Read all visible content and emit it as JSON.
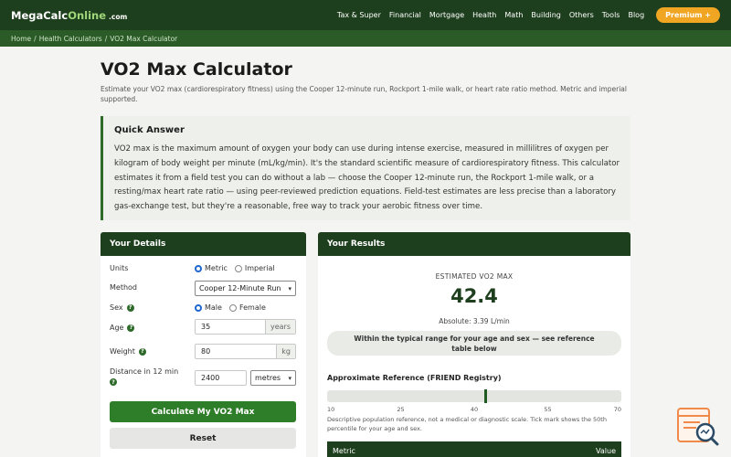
{
  "brand": {
    "name_main": "MegaCalc",
    "name_accent": "Online",
    "tld": ".com"
  },
  "nav": {
    "items": [
      "Tax & Super",
      "Financial",
      "Mortgage",
      "Health",
      "Math",
      "Building",
      "Others",
      "Tools",
      "Blog"
    ],
    "premium_label": "Premium +"
  },
  "breadcrumb": {
    "home": "Home",
    "section": "Health Calculators",
    "current": "VO2 Max Calculator",
    "separator": "/"
  },
  "page": {
    "title": "VO2 Max Calculator",
    "subtitle": "Estimate your VO2 max (cardiorespiratory fitness) using the Cooper 12-minute run, Rockport 1-mile walk, or heart rate ratio method. Metric and imperial supported."
  },
  "quick_answer": {
    "heading": "Quick Answer",
    "body": "VO2 max is the maximum amount of oxygen your body can use during intense exercise, measured in millilitres of oxygen per kilogram of body weight per minute (mL/kg/min). It's the standard scientific measure of cardiorespiratory fitness. This calculator estimates it from a field test you can do without a lab — choose the Cooper 12-minute run, the Rockport 1-mile walk, or a resting/max heart rate ratio — using peer-reviewed prediction equations. Field-test estimates are less precise than a laboratory gas-exchange test, but they're a reasonable, free way to track your aerobic fitness over time."
  },
  "details": {
    "heading": "Your Details",
    "units_label": "Units",
    "unit_metric": "Metric",
    "unit_imperial": "Imperial",
    "units_selected": "metric",
    "method_label": "Method",
    "method_value": "Cooper 12-Minute Run",
    "sex_label": "Sex",
    "sex_male": "Male",
    "sex_female": "Female",
    "sex_selected": "male",
    "age_label": "Age",
    "age_value": "35",
    "age_unit": "years",
    "weight_label": "Weight",
    "weight_value": "80",
    "weight_unit": "kg",
    "distance_label": "Distance in 12 min",
    "distance_value": "2400",
    "distance_unit": "metres",
    "calculate_label": "Calculate My VO2 Max",
    "reset_label": "Reset",
    "info_glyph": "?"
  },
  "results": {
    "heading": "Your Results",
    "estimate_label": "ESTIMATED VO2 MAX",
    "estimate_value": "42.4",
    "absolute_text": "Absolute: 3.39 L/min",
    "range_message": "Within the typical range for your age and sex — see reference table below",
    "reference_title": "Approximate Reference (FRIEND Registry)",
    "scale_ticks": [
      "10",
      "25",
      "40",
      "55",
      "70"
    ],
    "scale_min": 10,
    "scale_max": 70,
    "marker_value": 42.4,
    "reference_note": "Descriptive population reference, not a medical or diagnostic scale. Tick mark shows the 50th percentile for your age and sex.",
    "table_header_metric": "Metric",
    "table_header_value": "Value"
  },
  "colors": {
    "header_green": "#1e3f1d",
    "breadcrumb_green": "#2b5c28",
    "button_green": "#2e7d28",
    "premium_orange": "#f0a623",
    "radio_blue": "#1e66d0"
  },
  "icons": {
    "info": "info-icon",
    "select_chevron": "chevron-down-icon",
    "widget": "search-document-icon"
  }
}
